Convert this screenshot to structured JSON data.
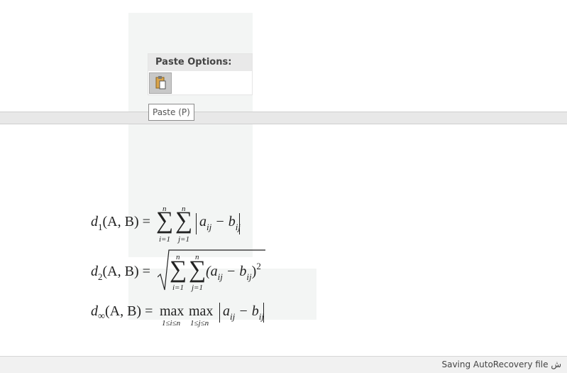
{
  "paste_menu": {
    "header": "Paste Options:",
    "keep_text_button": "paste-keep-source-icon",
    "tooltip": "Paste (P)"
  },
  "equations": {
    "d1": {
      "lhs_d": "d",
      "lhs_sub": "1",
      "lhs_args": "(A, B) =",
      "sum1_upper": "n",
      "sum1_lower": "i=1",
      "sum2_upper": "n",
      "sum2_lower": "j=1",
      "body": "a",
      "body_sub_a": "ij",
      "minus": " − b",
      "body_sub_b": "ij"
    },
    "d2": {
      "lhs_d": "d",
      "lhs_sub": "2",
      "lhs_args": "(A, B) =",
      "sum1_upper": "n",
      "sum1_lower": "i=1",
      "sum2_upper": "n",
      "sum2_lower": "j=1",
      "body_open": "(a",
      "body_sub_a": "ij",
      "minus": " − b",
      "body_sub_b": "ij",
      "close": ")",
      "power": "2"
    },
    "dinf": {
      "lhs_d": "d",
      "lhs_sub": "∞",
      "lhs_args": "(A, B) =",
      "max1": "max",
      "max1_lower": "1≤i≤n",
      "max2": "max",
      "max2_lower": "1≤j≤n",
      "body": "a",
      "body_sub_a": "ij",
      "minus": " − b",
      "body_sub_b": "ij"
    }
  },
  "status_bar": {
    "text": "Saving AutoRecovery file ش"
  }
}
